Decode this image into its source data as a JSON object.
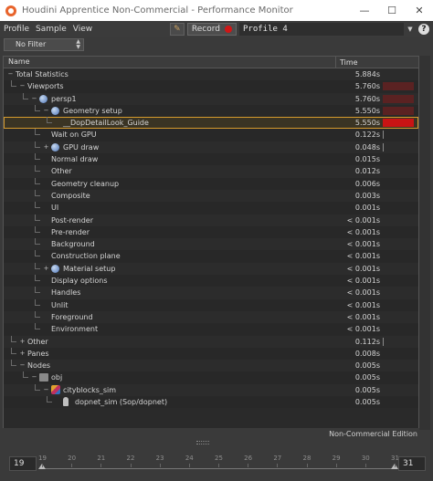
{
  "window": {
    "title": "Houdini Apprentice Non-Commercial - Performance Monitor",
    "minimize": "—",
    "maximize": "☐",
    "close": "✕"
  },
  "menu": {
    "items": [
      "Profile",
      "Sample",
      "View"
    ],
    "record_label": "Record",
    "profile_name": "Profile 4",
    "help": "?"
  },
  "filter": {
    "value": "No Filter"
  },
  "table": {
    "col_name": "Name",
    "col_time": "Time",
    "rows": [
      {
        "label": "Total Statistics",
        "time": "5.884s",
        "depth": 0,
        "exp": "−",
        "icon": "",
        "bar": 0
      },
      {
        "label": "Viewports",
        "time": "5.760s",
        "depth": 1,
        "exp": "−",
        "icon": "",
        "bar": 0.9
      },
      {
        "label": "persp1",
        "time": "5.760s",
        "depth": 2,
        "exp": "−",
        "icon": "globe",
        "bar": 0.9
      },
      {
        "label": "Geometry setup",
        "time": "5.550s",
        "depth": 3,
        "exp": "−",
        "icon": "globe",
        "bar": 0.9
      },
      {
        "label": "__DopDetailLook_Guide",
        "time": "5.550s",
        "depth": 4,
        "exp": "",
        "icon": "",
        "bar": 0.9,
        "selected": true
      },
      {
        "label": "Wait on GPU",
        "time": "0.122s",
        "depth": 3,
        "exp": "",
        "icon": "",
        "bar": 0.02
      },
      {
        "label": "GPU draw",
        "time": "0.048s",
        "depth": 3,
        "exp": "+",
        "icon": "globe",
        "bar": 0.01
      },
      {
        "label": "Normal draw",
        "time": "0.015s",
        "depth": 3,
        "exp": "",
        "icon": "",
        "bar": 0
      },
      {
        "label": "Other",
        "time": "0.012s",
        "depth": 3,
        "exp": "",
        "icon": "",
        "bar": 0
      },
      {
        "label": "Geometry cleanup",
        "time": "0.006s",
        "depth": 3,
        "exp": "",
        "icon": "",
        "bar": 0
      },
      {
        "label": "Composite",
        "time": "0.003s",
        "depth": 3,
        "exp": "",
        "icon": "",
        "bar": 0
      },
      {
        "label": "UI",
        "time": "0.001s",
        "depth": 3,
        "exp": "",
        "icon": "",
        "bar": 0
      },
      {
        "label": "Post-render",
        "time": "< 0.001s",
        "depth": 3,
        "exp": "",
        "icon": "",
        "bar": 0
      },
      {
        "label": "Pre-render",
        "time": "< 0.001s",
        "depth": 3,
        "exp": "",
        "icon": "",
        "bar": 0
      },
      {
        "label": "Background",
        "time": "< 0.001s",
        "depth": 3,
        "exp": "",
        "icon": "",
        "bar": 0
      },
      {
        "label": "Construction plane",
        "time": "< 0.001s",
        "depth": 3,
        "exp": "",
        "icon": "",
        "bar": 0
      },
      {
        "label": "Material setup",
        "time": "< 0.001s",
        "depth": 3,
        "exp": "+",
        "icon": "globe",
        "bar": 0
      },
      {
        "label": "Display options",
        "time": "< 0.001s",
        "depth": 3,
        "exp": "",
        "icon": "",
        "bar": 0
      },
      {
        "label": "Handles",
        "time": "< 0.001s",
        "depth": 3,
        "exp": "",
        "icon": "",
        "bar": 0
      },
      {
        "label": "Unlit",
        "time": "< 0.001s",
        "depth": 3,
        "exp": "",
        "icon": "",
        "bar": 0
      },
      {
        "label": "Foreground",
        "time": "< 0.001s",
        "depth": 3,
        "exp": "",
        "icon": "",
        "bar": 0
      },
      {
        "label": "Environment",
        "time": "< 0.001s",
        "depth": 3,
        "exp": "",
        "icon": "",
        "bar": 0
      },
      {
        "label": "Other",
        "time": "0.112s",
        "depth": 1,
        "exp": "+",
        "icon": "",
        "bar": 0.02
      },
      {
        "label": "Panes",
        "time": "0.008s",
        "depth": 1,
        "exp": "+",
        "icon": "",
        "bar": 0
      },
      {
        "label": "Nodes",
        "time": "0.005s",
        "depth": 1,
        "exp": "−",
        "icon": "",
        "bar": 0
      },
      {
        "label": "obj",
        "time": "0.005s",
        "depth": 2,
        "exp": "−",
        "icon": "obj",
        "bar": 0
      },
      {
        "label": "cityblocks_sim",
        "time": "0.005s",
        "depth": 3,
        "exp": "−",
        "icon": "sim",
        "bar": 0
      },
      {
        "label": "dopnet_sim (Sop/dopnet)",
        "time": "0.005s",
        "depth": 4,
        "exp": "",
        "icon": "dop",
        "bar": 0
      }
    ]
  },
  "footer": {
    "edition": "Non-Commercial Edition"
  },
  "timeline": {
    "start_frame": "19",
    "end_frame": "31",
    "ticks": [
      "19",
      "20",
      "21",
      "22",
      "23",
      "24",
      "25",
      "26",
      "27",
      "28",
      "29",
      "30",
      "31"
    ]
  },
  "colors": {
    "bar_full": "#c81414",
    "bar_dim": "#5a2222",
    "selection_outline": "#d59a2d"
  }
}
